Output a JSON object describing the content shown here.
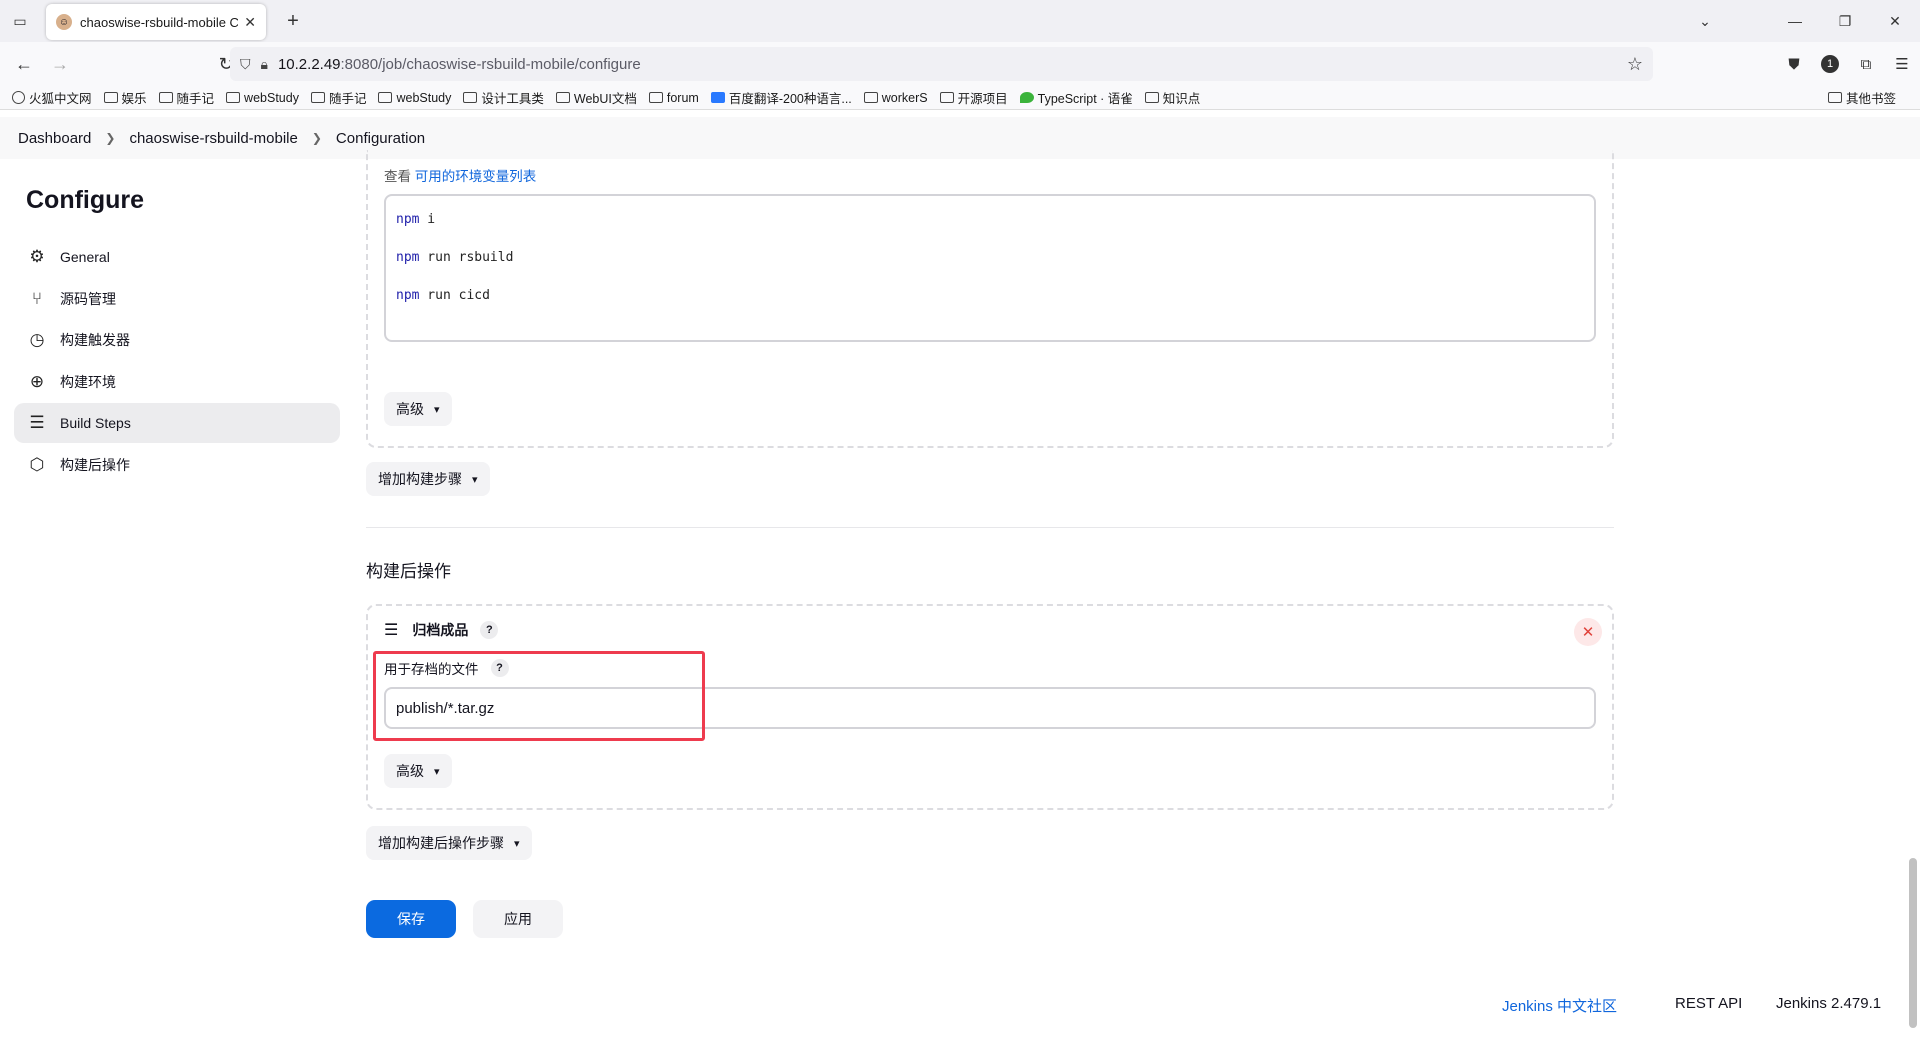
{
  "browser": {
    "tab_title": "chaoswise-rsbuild-mobile Co",
    "url_host": "10.2.2.49",
    "url_path": ":8080/job/chaoswise-rsbuild-mobile/configure",
    "extension_badge": "1"
  },
  "bookmarks": [
    "火狐中文网",
    "娱乐",
    "随手记",
    "webStudy",
    "随手记",
    "webStudy",
    "设计工具类",
    "WebUI文档",
    "forum",
    "百度翻译-200种语言...",
    "workerS",
    "开源项目",
    "TypeScript · 语雀",
    "知识点"
  ],
  "bookmarks_other": "其他书签",
  "breadcrumb": [
    "Dashboard",
    "chaoswise-rsbuild-mobile",
    "Configuration"
  ],
  "sidebar": {
    "title": "Configure",
    "items": [
      {
        "label": "General",
        "icon": "gear-icon"
      },
      {
        "label": "源码管理",
        "icon": "branch-icon"
      },
      {
        "label": "构建触发器",
        "icon": "clock-icon"
      },
      {
        "label": "构建环境",
        "icon": "globe-icon"
      },
      {
        "label": "Build Steps",
        "icon": "list-icon"
      },
      {
        "label": "构建后操作",
        "icon": "cube-icon"
      }
    ]
  },
  "build": {
    "env_prefix": "查看",
    "env_link": "可用的环境变量列表",
    "commands": [
      {
        "cmd": "npm",
        "args": " i"
      },
      {
        "cmd": "npm",
        "args": " run rsbuild"
      },
      {
        "cmd": "npm",
        "args": " run cicd"
      }
    ],
    "advanced": "高级",
    "add_step": "增加构建步骤"
  },
  "post_build": {
    "section_title": "构建后操作",
    "step_title": "归档成品",
    "help": "?",
    "field_label": "用于存档的文件",
    "field_value": "publish/*.tar.gz",
    "advanced": "高级",
    "add_step": "增加构建后操作步骤"
  },
  "actions": {
    "save": "保存",
    "apply": "应用"
  },
  "footer": {
    "community": "Jenkins 中文社区",
    "rest_api": "REST API",
    "version": "Jenkins 2.479.1"
  },
  "colors": {
    "primary": "#0b6ae0",
    "highlight": "#ee3b4e",
    "link": "#1066dc"
  }
}
